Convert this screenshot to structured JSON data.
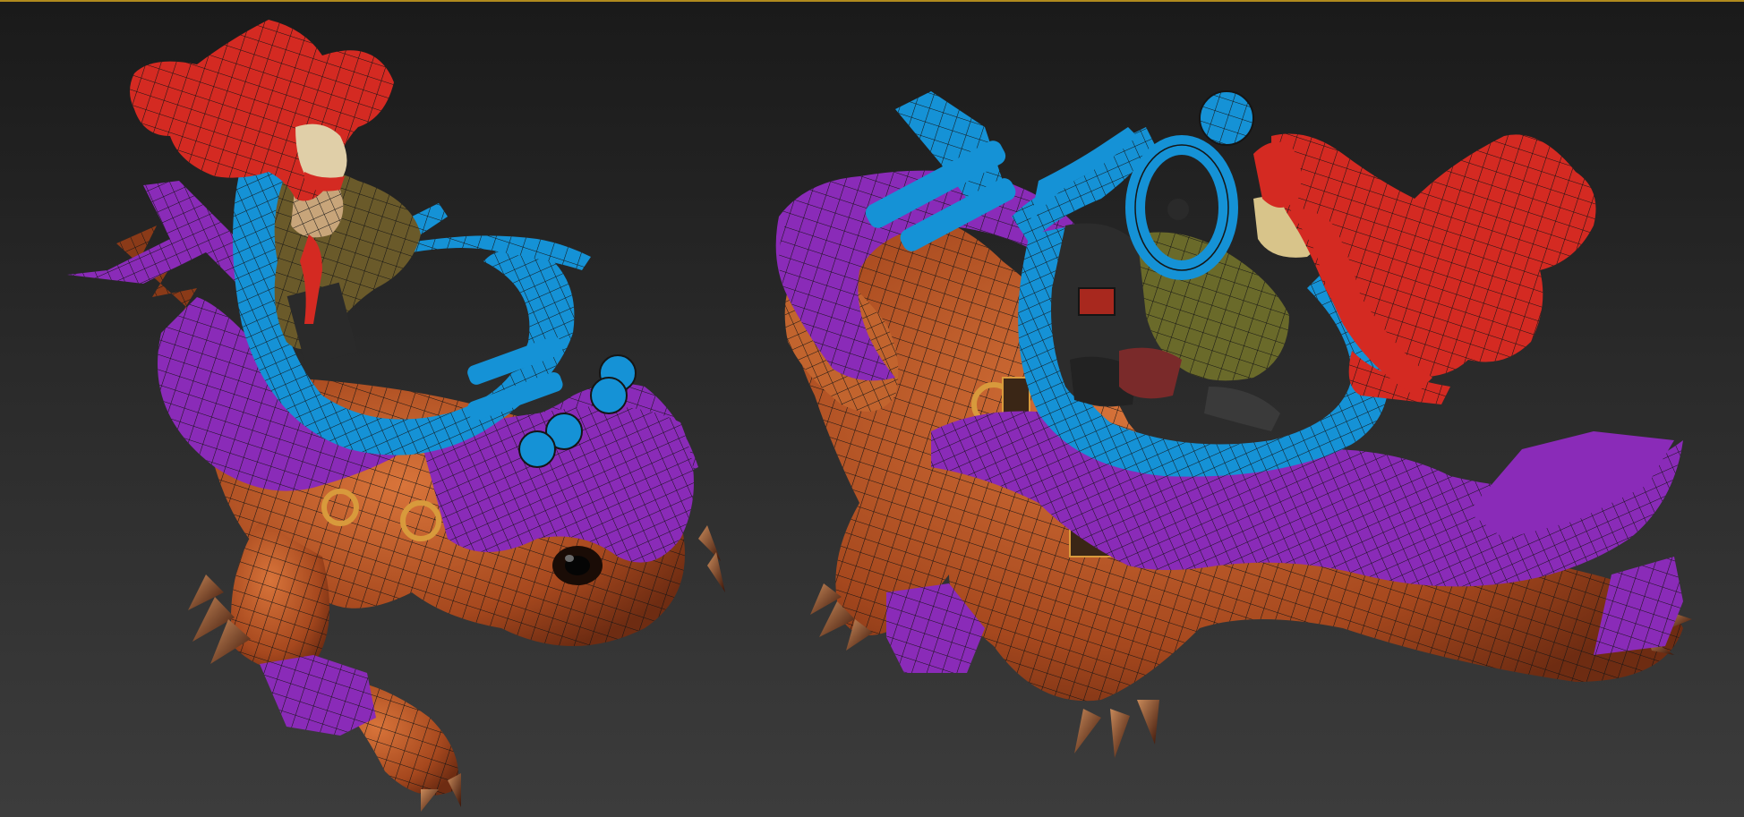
{
  "viewport": {
    "border_color": "#b08a1e",
    "background_top": "#1a1a1a",
    "background_bottom": "#3c3c3c"
  },
  "palette": {
    "red_selection": "#d42a22",
    "blue_selection": "#1592d6",
    "purple_selection": "#8a2bb8",
    "creature_skin": "#b8582a",
    "skin_dark": "#7a3416",
    "wire": "#151515"
  },
  "models": [
    {
      "view": "left",
      "element_id": "model-left"
    },
    {
      "view": "right",
      "element_id": "model-right"
    }
  ]
}
